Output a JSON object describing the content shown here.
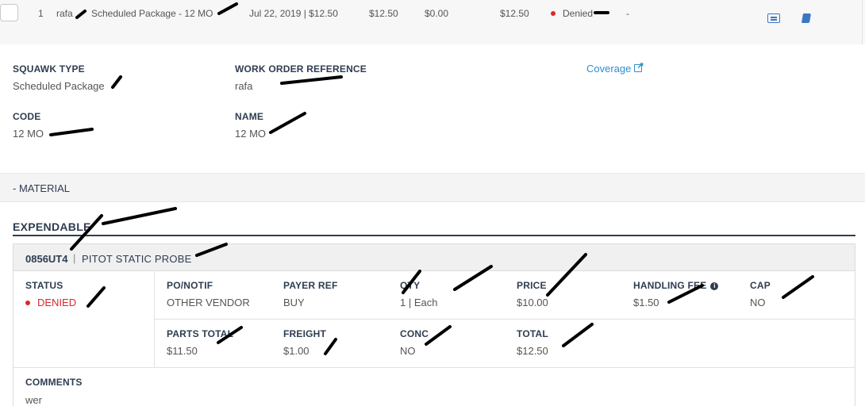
{
  "row": {
    "index": "1",
    "wo_ref": "rafa",
    "squawk": "Scheduled Package - 12 MO",
    "date_amount": "Jul 22, 2019 | $12.50",
    "amount1": "$12.50",
    "amount2": "$0.00",
    "amount3": "$12.50",
    "status": "Denied",
    "dash": "-"
  },
  "details": {
    "squawk_type_label": "SQUAWK TYPE",
    "squawk_type_value": "Scheduled Package",
    "wo_ref_label": "WORK ORDER REFERENCE",
    "wo_ref_value": "rafa",
    "coverage_link": "Coverage",
    "code_label": "CODE",
    "code_value": "12 MO",
    "name_label": "NAME",
    "name_value": "12 MO"
  },
  "material": {
    "header": "- MATERIAL",
    "expendable_title": "EXPENDABLE",
    "part": {
      "number": "0856UT4",
      "separator": "|",
      "description": "PITOT STATIC PROBE",
      "status_label": "STATUS",
      "status_value": "DENIED",
      "po_label": "PO/NOTIF",
      "po_value": "OTHER VENDOR",
      "payer_label": "PAYER REF",
      "payer_value": "BUY",
      "qty_label": "QTY",
      "qty_value": "1 | Each",
      "price_label": "PRICE",
      "price_value": "$10.00",
      "handling_label": "HANDLING FEE",
      "handling_value": "$1.50",
      "cap_label": "CAP",
      "cap_value": "NO",
      "parts_total_label": "PARTS TOTAL",
      "parts_total_value": "$11.50",
      "freight_label": "FREIGHT",
      "freight_value": "$1.00",
      "conc_label": "CONC",
      "conc_value": "NO",
      "total_label": "TOTAL",
      "total_value": "$12.50",
      "comments_label": "COMMENTS",
      "comments_value": "wer"
    }
  },
  "icons": {
    "row_action_1": "id-card-icon",
    "row_action_2": "book-icon",
    "coverage": "external-link-icon",
    "handling_info": "info-circle-icon"
  },
  "colors": {
    "denied": "#d9292b",
    "link": "#2e8ecf",
    "heading": "#2e3d50"
  }
}
